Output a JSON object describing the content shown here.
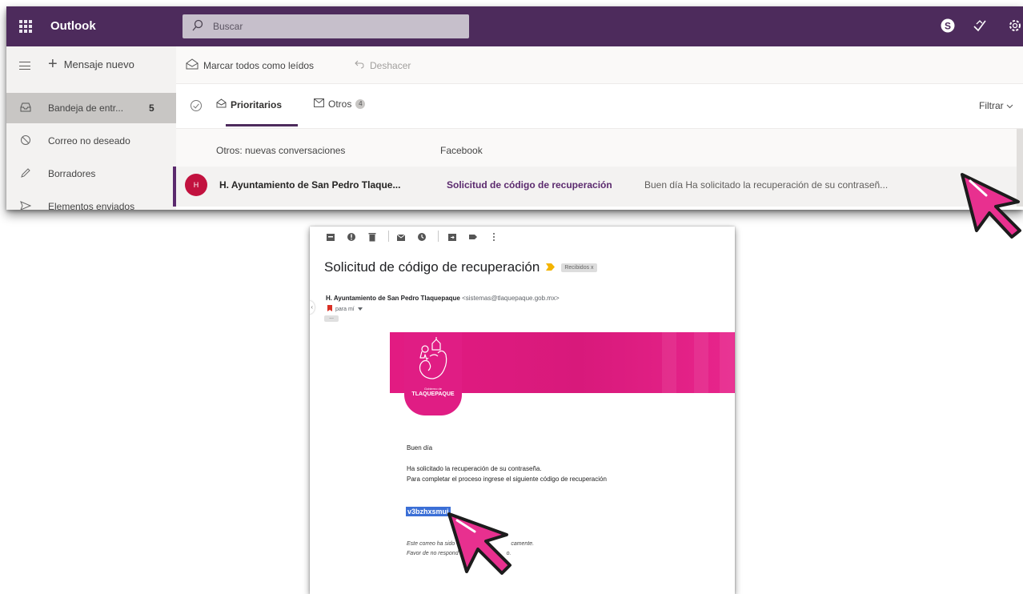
{
  "outlook": {
    "app_name": "Outlook",
    "search_placeholder": "Buscar",
    "new_message": "Mensaje nuevo",
    "mark_all_read": "Marcar todos como leídos",
    "undo": "Deshacer",
    "folders": [
      {
        "label": "Bandeja de entr...",
        "count": "5"
      },
      {
        "label": "Correo no deseado"
      },
      {
        "label": "Borradores"
      },
      {
        "label": "Elementos enviados"
      }
    ],
    "tabs": {
      "focused": "Prioritarios",
      "other": "Otros",
      "other_count": "4"
    },
    "filter": "Filtrar",
    "other_row": {
      "label": "Otros: nuevas conversaciones",
      "source": "Facebook"
    },
    "message": {
      "avatar": "H",
      "sender": "H. Ayuntamiento de San Pedro Tlaque...",
      "subject": "Solicitud de código de recuperación",
      "preview": "Buen día Ha solicitado la recuperación de su contraseñ..."
    }
  },
  "email": {
    "subject": "Solicitud de código de recuperación",
    "label": "Recibidos",
    "sender_name": "H. Ayuntamiento de San Pedro Tlaquepaque",
    "sender_email": "<sistemas@tlaquepaque.gob.mx>",
    "to": "para mí",
    "logo_small": "Gobierno de",
    "logo_big": "TLAQUEPAQUE",
    "greeting": "Buen día",
    "line1": "Ha solicitado la recuperación de su contraseña.",
    "line2": "Para completar el proceso ingrese el siguiente código de recuperación",
    "code": "v3bzhxsmui",
    "footer1": "Este correo ha sido",
    "footer1_end": "camente.",
    "footer2": "Favor de no respond",
    "footer2_end": "o."
  },
  "colors": {
    "outlook_purple": "#4d2b5c",
    "brand_pink": "#e01d84",
    "cursor_pink": "#e8308f",
    "avatar_red": "#c2123f",
    "selection_blue": "#3b6fd6"
  },
  "icons": [
    "waffle-icon",
    "search-icon",
    "skype-icon",
    "sync-icon",
    "gear-icon",
    "hamburger-icon",
    "plus-icon",
    "envelope-open-icon",
    "undo-icon",
    "inbox-icon",
    "block-icon",
    "pencil-icon",
    "send-icon",
    "mouse-pointer-icon"
  ]
}
